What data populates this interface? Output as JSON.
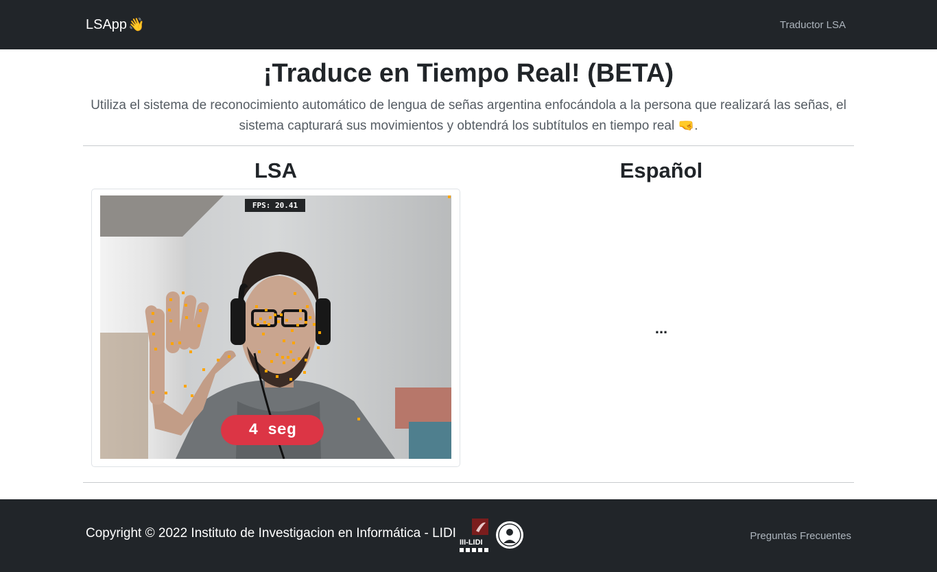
{
  "navbar": {
    "brand": "LSApp",
    "brand_emoji": "👋",
    "link": "Traductor LSA"
  },
  "header": {
    "title": "¡Traduce en Tiempo Real! (BETA)",
    "lead": "Utiliza el sistema de reconocimiento automático de lengua de señas argentina enfocándola a la persona que realizará las señas, el sistema capturará sus movimientos y obtendrá los subtítulos en tiempo real",
    "lead_emoji": "🤜"
  },
  "lsa_panel": {
    "title": "LSA",
    "fps": "FPS: 20.41",
    "countdown": "4 seg"
  },
  "spanish_panel": {
    "title": "Español",
    "translation": "..."
  },
  "footer": {
    "copyright": "Copyright © 2022 Instituto de Investigacion en Informática - LIDI",
    "logo_text": "III-LIDI",
    "faq": "Preguntas Frecuentes"
  },
  "colors": {
    "dark": "#212529",
    "danger": "#dc3545",
    "landmarks": "#ffa500",
    "muted_link": "#adb5bd"
  }
}
